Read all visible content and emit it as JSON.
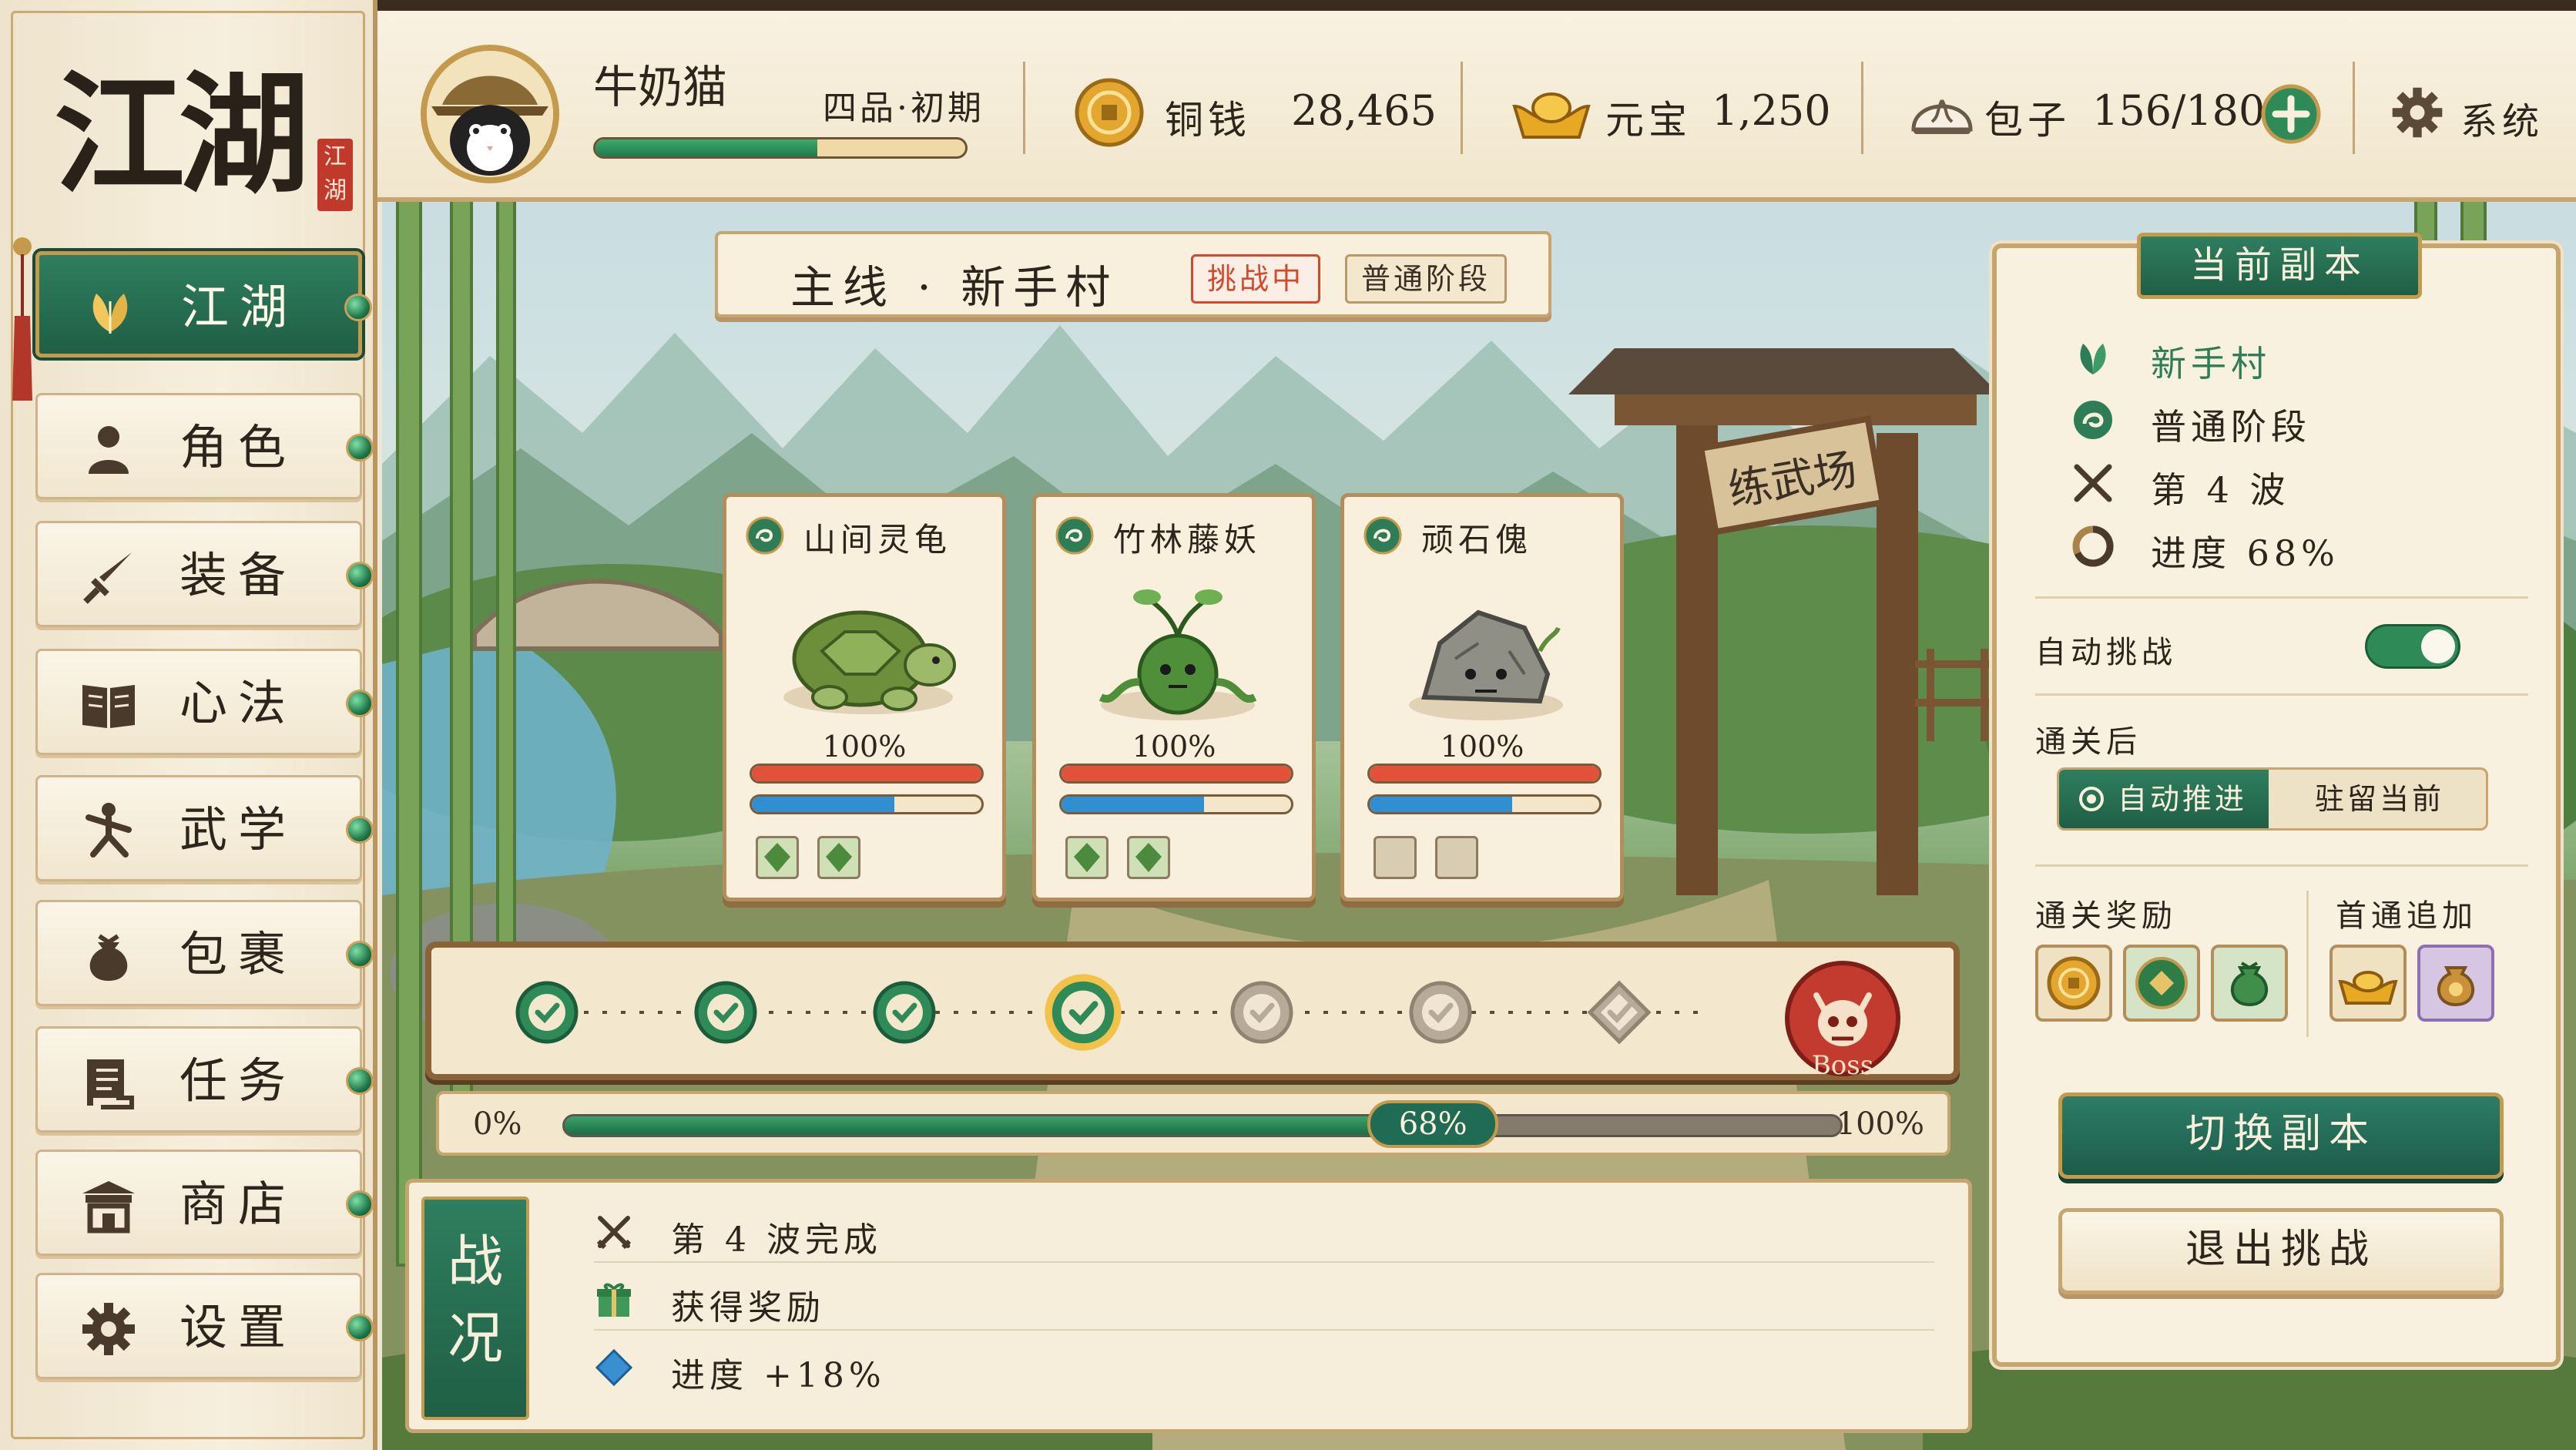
{
  "logo": {
    "title": "江湖",
    "seal": "江湖"
  },
  "sidebar": {
    "items": [
      {
        "label": "江湖",
        "icon": "leaf-icon",
        "active": true
      },
      {
        "label": "角色",
        "icon": "person-icon"
      },
      {
        "label": "装备",
        "icon": "sword-icon"
      },
      {
        "label": "心法",
        "icon": "book-icon"
      },
      {
        "label": "武学",
        "icon": "martial-stance-icon"
      },
      {
        "label": "包裹",
        "icon": "bag-icon"
      },
      {
        "label": "任务",
        "icon": "scroll-icon"
      },
      {
        "label": "商店",
        "icon": "shop-icon"
      },
      {
        "label": "设置",
        "icon": "gear-icon"
      }
    ]
  },
  "player": {
    "name": "牛奶猫",
    "rank": "四品·初期",
    "xp_progress": 0.6
  },
  "resources": {
    "copper": {
      "label": "铜钱",
      "value": "28,465"
    },
    "ingot": {
      "label": "元宝",
      "value": "1,250"
    },
    "bun": {
      "label": "包子",
      "value": "156/180"
    },
    "system_label": "系统"
  },
  "stage": {
    "title": "主线 · 新手村",
    "status_tag": "挑战中",
    "phase_tag": "普通阶段",
    "scene_sign": "练武场"
  },
  "enemies": [
    {
      "name": "山间灵龟",
      "hp_text": "100%",
      "hp": 1.0,
      "mp": 0.62,
      "art": "turtle",
      "slots_filled": 2
    },
    {
      "name": "竹林藤妖",
      "hp_text": "100%",
      "hp": 1.0,
      "mp": 0.62,
      "art": "vine",
      "slots_filled": 2
    },
    {
      "name": "顽石傀",
      "hp_text": "100%",
      "hp": 1.0,
      "mp": 0.62,
      "art": "rock",
      "slots_filled": 0
    }
  ],
  "waves": {
    "total": 8,
    "completed": 4,
    "current": 4,
    "boss_label": "Boss"
  },
  "progress": {
    "start_label": "0%",
    "end_label": "100%",
    "value_label": "68%",
    "value": 0.68
  },
  "battle_log": {
    "tab_label": "战况",
    "rows": [
      {
        "text": "第 4 波完成",
        "icon": "crossed-swords-icon"
      },
      {
        "text": "获得奖励",
        "icon": "gift-icon"
      },
      {
        "text": "进度 +18%",
        "icon": "diamond-icon"
      }
    ]
  },
  "dungeon": {
    "header": "当前副本",
    "info": [
      {
        "text": "新手村",
        "icon": "leaf-icon"
      },
      {
        "text": "普通阶段",
        "icon": "swirl-icon"
      },
      {
        "text": "第 4 波",
        "icon": "crossed-swords-icon"
      },
      {
        "text": "进度  68%",
        "icon": "ring-icon"
      }
    ],
    "auto_challenge_label": "自动挑战",
    "auto_challenge_on": true,
    "after_clear_label": "通关后",
    "option_auto": "自动推进",
    "option_stay": "驻留当前",
    "reward_label": "通关奖励",
    "first_clear_label": "首通追加",
    "switch_button": "切换副本",
    "exit_button": "退出挑战"
  },
  "colors": {
    "jade": "#1f5f45",
    "gold": "#c49a4d",
    "parchment": "#f8f1e0",
    "hp_red": "#e0533a",
    "mp_blue": "#2f8fd1"
  }
}
